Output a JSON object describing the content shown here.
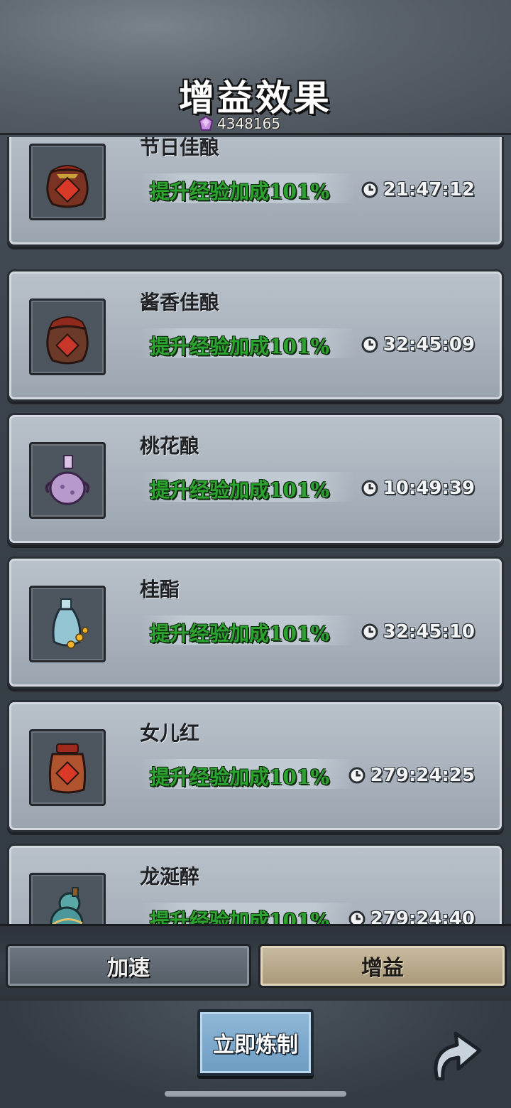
{
  "header": {
    "title": "增益效果",
    "currency_icon": "purple-gem-icon",
    "currency_value": "4348165"
  },
  "items": [
    {
      "name": "节日佳酿",
      "effect": "提升经验加成101%",
      "time": "21:47:12",
      "icon": "red-wine-jar-icon"
    },
    {
      "name": "酱香佳酿",
      "effect": "提升经验加成101%",
      "time": "32:45:09",
      "icon": "brown-wine-jar-icon"
    },
    {
      "name": "桃花酿",
      "effect": "提升经验加成101%",
      "time": "10:49:39",
      "icon": "purple-flask-icon"
    },
    {
      "name": "桂酯",
      "effect": "提升经验加成101%",
      "time": "32:45:10",
      "icon": "blue-vase-icon"
    },
    {
      "name": "女儿红",
      "effect": "提升经验加成101%",
      "time": "279:24:25",
      "icon": "red-wine-pot-icon"
    },
    {
      "name": "龙涎醉",
      "effect": "提升经验加成101%",
      "time": "279:24:40",
      "icon": "teal-gourd-icon"
    }
  ],
  "tabs": {
    "speed_label": "加速",
    "boost_label": "增益",
    "active": "增益"
  },
  "actions": {
    "craft_label": "立即炼制",
    "share_icon": "share-arrow-icon"
  },
  "colors": {
    "effect_text": "#2da42f",
    "card_bg": "#a8b1bb",
    "active_tab": "#c9bba0",
    "craft_button": "#7ba9cc"
  }
}
